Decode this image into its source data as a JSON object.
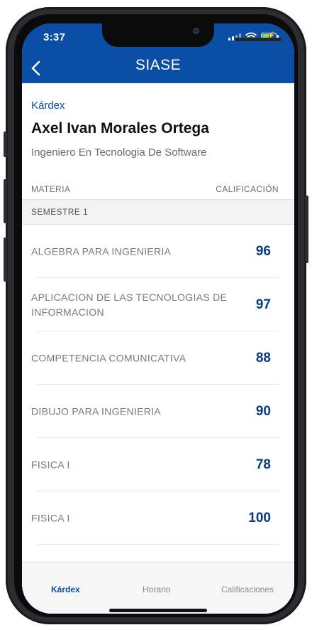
{
  "status_bar": {
    "time": "3:37"
  },
  "header": {
    "title": "SIASE"
  },
  "page": {
    "section_label": "Kárdex",
    "student_name": "Axel Ivan Morales Ortega",
    "career": "Ingeniero En Tecnologia De Software"
  },
  "table": {
    "col_subject": "MATERIA",
    "col_grade": "CALIFICACIÓN",
    "semester_label": "SEMESTRE 1",
    "rows": [
      {
        "subject": "ALGEBRA PARA INGENIERIA",
        "grade": "96"
      },
      {
        "subject": "APLICACION DE LAS TECNOLOGIAS DE INFORMACION",
        "grade": "97"
      },
      {
        "subject": "COMPETENCIA COMUNICATIVA",
        "grade": "88"
      },
      {
        "subject": "DIBUJO PARA INGENIERIA",
        "grade": "90"
      },
      {
        "subject": "FISICA I",
        "grade": "78"
      },
      {
        "subject": "FISICA I",
        "grade": "100"
      }
    ]
  },
  "tabs": [
    {
      "label": "Kárdex",
      "active": true
    },
    {
      "label": "Horario",
      "active": false
    },
    {
      "label": "Calificaciones",
      "active": false
    }
  ],
  "colors": {
    "brand": "#0b4ea6",
    "grade": "#0b3a82"
  }
}
